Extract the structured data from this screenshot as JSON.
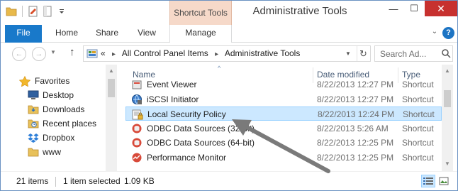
{
  "window": {
    "title": "Administrative Tools",
    "contextual_tab_header": "Shortcut Tools",
    "close_label": "✕",
    "min_label": "—",
    "max_label": "☐"
  },
  "ribbon": {
    "tabs": [
      {
        "id": "file",
        "label": "File"
      },
      {
        "id": "home",
        "label": "Home"
      },
      {
        "id": "share",
        "label": "Share"
      },
      {
        "id": "view",
        "label": "View"
      },
      {
        "id": "manage",
        "label": "Manage"
      }
    ],
    "help_label": "?"
  },
  "address": {
    "prefix": "«",
    "crumbs": [
      "All Control Panel Items",
      "Administrative Tools"
    ],
    "search_placeholder": "Search Ad..."
  },
  "navpane": {
    "favorites_label": "Favorites",
    "items": [
      {
        "label": "Desktop",
        "icon": "desktop-icon"
      },
      {
        "label": "Downloads",
        "icon": "downloads-folder-icon"
      },
      {
        "label": "Recent places",
        "icon": "recent-places-icon"
      },
      {
        "label": "Dropbox",
        "icon": "dropbox-icon"
      },
      {
        "label": "www",
        "icon": "folder-icon"
      }
    ]
  },
  "filelist": {
    "columns": {
      "name": "Name",
      "date": "Date modified",
      "type": "Type"
    },
    "rows": [
      {
        "name": "Event Viewer",
        "date": "8/22/2013 12:27 PM",
        "type": "Shortcut",
        "icon": "event-viewer-icon",
        "selected": false
      },
      {
        "name": "iSCSI Initiator",
        "date": "8/22/2013 12:27 PM",
        "type": "Shortcut",
        "icon": "iscsi-icon",
        "selected": false
      },
      {
        "name": "Local Security Policy",
        "date": "8/22/2013 12:24 PM",
        "type": "Shortcut",
        "icon": "security-policy-icon",
        "selected": true
      },
      {
        "name": "ODBC Data Sources (32-bit)",
        "date": "8/22/2013 5:26 AM",
        "type": "Shortcut",
        "icon": "odbc-icon",
        "selected": false
      },
      {
        "name": "ODBC Data Sources (64-bit)",
        "date": "8/22/2013 12:25 PM",
        "type": "Shortcut",
        "icon": "odbc-icon",
        "selected": false
      },
      {
        "name": "Performance Monitor",
        "date": "8/22/2013 12:25 PM",
        "type": "Shortcut",
        "icon": "perf-monitor-icon",
        "selected": false
      }
    ]
  },
  "status": {
    "count": "21 items",
    "selected": "1 item selected",
    "size": "1.09 KB"
  },
  "colors": {
    "file_tab": "#1979ca",
    "selection_bg": "#cce8ff",
    "selection_border": "#99d1ff",
    "close_button": "#c7312f",
    "contextual_header": "#f6d9c9",
    "annotation_arrow": "#7a7a7a"
  }
}
